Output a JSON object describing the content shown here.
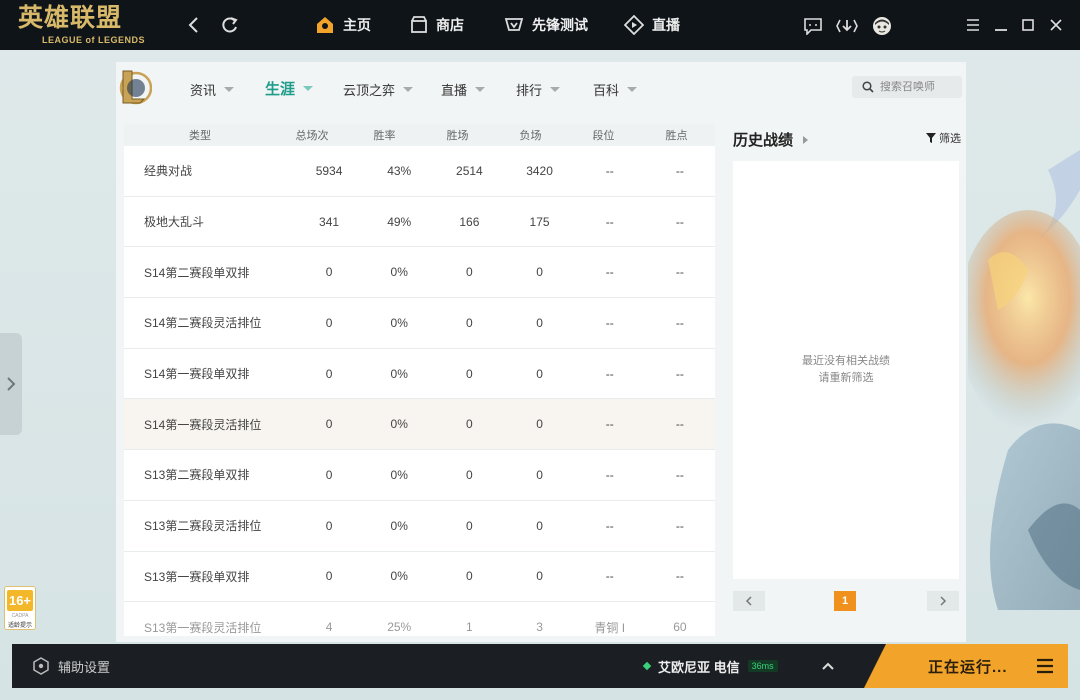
{
  "brand": {
    "name_cn": "英雄联盟",
    "name_en": "LEAGUE of LEGENDS"
  },
  "topnav": [
    {
      "label": "主页",
      "icon": "home-icon"
    },
    {
      "label": "商店",
      "icon": "store-icon"
    },
    {
      "label": "先锋测试",
      "icon": "vanguard-icon"
    },
    {
      "label": "直播",
      "icon": "live-icon"
    }
  ],
  "subnav": {
    "items": [
      {
        "label": "资讯"
      },
      {
        "label": "生涯",
        "active": true
      },
      {
        "label": "云顶之弈"
      },
      {
        "label": "直播"
      },
      {
        "label": "排行"
      },
      {
        "label": "百科"
      }
    ],
    "search_placeholder": "搜索召唤师"
  },
  "table": {
    "headers": [
      "类型",
      "总场次",
      "胜率",
      "胜场",
      "负场",
      "段位",
      "胜点"
    ],
    "rows": [
      [
        "经典对战",
        "5934",
        "43%",
        "2514",
        "3420",
        "--",
        "--"
      ],
      [
        "极地大乱斗",
        "341",
        "49%",
        "166",
        "175",
        "--",
        "--"
      ],
      [
        "S14第二赛段单双排",
        "0",
        "0%",
        "0",
        "0",
        "--",
        "--"
      ],
      [
        "S14第二赛段灵活排位",
        "0",
        "0%",
        "0",
        "0",
        "--",
        "--"
      ],
      [
        "S14第一赛段单双排",
        "0",
        "0%",
        "0",
        "0",
        "--",
        "--"
      ],
      [
        "S14第一赛段灵活排位",
        "0",
        "0%",
        "0",
        "0",
        "--",
        "--"
      ],
      [
        "S13第二赛段单双排",
        "0",
        "0%",
        "0",
        "0",
        "--",
        "--"
      ],
      [
        "S13第二赛段灵活排位",
        "0",
        "0%",
        "0",
        "0",
        "--",
        "--"
      ],
      [
        "S13第一赛段单双排",
        "0",
        "0%",
        "0",
        "0",
        "--",
        "--"
      ],
      [
        "S13第一赛段灵活排位",
        "4",
        "25%",
        "1",
        "3",
        "青铜 I",
        "60"
      ]
    ]
  },
  "history": {
    "title": "历史战绩",
    "filter_label": "筛选",
    "empty_line1": "最近没有相关战绩",
    "empty_line2": "请重新筛选",
    "page": "1"
  },
  "age_rating": {
    "num": "16+",
    "line1": "CADPA",
    "line2": "适龄提示"
  },
  "bottom": {
    "assist_label": "辅助设置",
    "server_name": "艾欧尼亚 电信",
    "ping": "36ms",
    "running_label": "正在运行..."
  },
  "colors": {
    "accent": "#1f9d8b",
    "orange": "#f2a42a",
    "topbar": "#0f1419"
  }
}
